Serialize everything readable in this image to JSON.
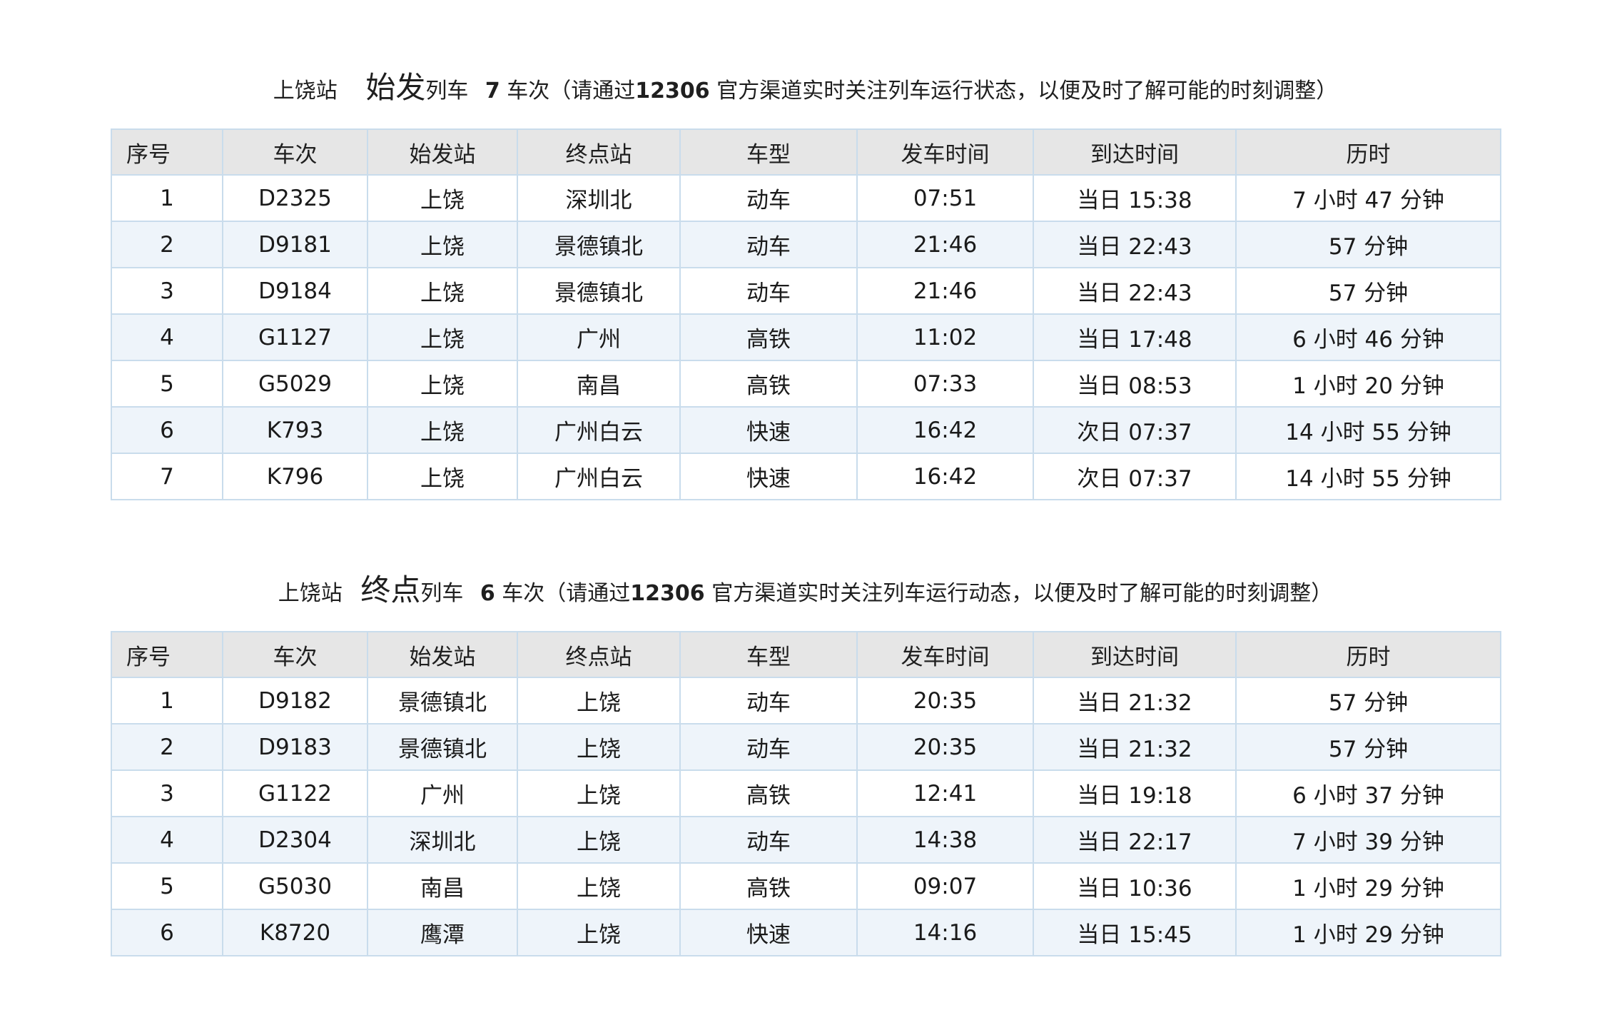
{
  "colors": {
    "header_bg": "#e6e6e6",
    "row_alt_bg": "#eef4fa",
    "border": "#c9dcec"
  },
  "sections": [
    {
      "station": "上饶站",
      "kind": "始发",
      "kind_suffix": "列车",
      "count": "7",
      "count_suffix": "车次（请通过",
      "note_highlight": "12306",
      "note_tail": "官方渠道实时关注列车运行状态，以便及时了解可能的时刻调整）",
      "columns": [
        "序号",
        "车次",
        "始发站",
        "终点站",
        "车型",
        "发车时间",
        "到达时间",
        "历时"
      ],
      "rows": [
        [
          "1",
          "D2325",
          "上饶",
          "深圳北",
          "动车",
          "07:51",
          "当日 15:38",
          "7 小时 47 分钟"
        ],
        [
          "2",
          "D9181",
          "上饶",
          "景德镇北",
          "动车",
          "21:46",
          "当日 22:43",
          "57 分钟"
        ],
        [
          "3",
          "D9184",
          "上饶",
          "景德镇北",
          "动车",
          "21:46",
          "当日 22:43",
          "57 分钟"
        ],
        [
          "4",
          "G1127",
          "上饶",
          "广州",
          "高铁",
          "11:02",
          "当日 17:48",
          "6 小时 46 分钟"
        ],
        [
          "5",
          "G5029",
          "上饶",
          "南昌",
          "高铁",
          "07:33",
          "当日 08:53",
          "1 小时 20 分钟"
        ],
        [
          "6",
          "K793",
          "上饶",
          "广州白云",
          "快速",
          "16:42",
          "次日 07:37",
          "14 小时 55 分钟"
        ],
        [
          "7",
          "K796",
          "上饶",
          "广州白云",
          "快速",
          "16:42",
          "次日 07:37",
          "14 小时 55 分钟"
        ]
      ]
    },
    {
      "station": "上饶站",
      "kind": "终点",
      "kind_suffix": "列车",
      "count": "6",
      "count_suffix": "车次（请通过",
      "note_highlight": "12306",
      "note_tail": "官方渠道实时关注列车运行动态，以便及时了解可能的时刻调整）",
      "columns": [
        "序号",
        "车次",
        "始发站",
        "终点站",
        "车型",
        "发车时间",
        "到达时间",
        "历时"
      ],
      "rows": [
        [
          "1",
          "D9182",
          "景德镇北",
          "上饶",
          "动车",
          "20:35",
          "当日 21:32",
          "57 分钟"
        ],
        [
          "2",
          "D9183",
          "景德镇北",
          "上饶",
          "动车",
          "20:35",
          "当日 21:32",
          "57 分钟"
        ],
        [
          "3",
          "G1122",
          "广州",
          "上饶",
          "高铁",
          "12:41",
          "当日 19:18",
          "6 小时 37 分钟"
        ],
        [
          "4",
          "D2304",
          "深圳北",
          "上饶",
          "动车",
          "14:38",
          "当日 22:17",
          "7 小时 39 分钟"
        ],
        [
          "5",
          "G5030",
          "南昌",
          "上饶",
          "高铁",
          "09:07",
          "当日 10:36",
          "1 小时 29 分钟"
        ],
        [
          "6",
          "K8720",
          "鹰潭",
          "上饶",
          "快速",
          "14:16",
          "当日 15:45",
          "1 小时 29 分钟"
        ]
      ]
    }
  ]
}
